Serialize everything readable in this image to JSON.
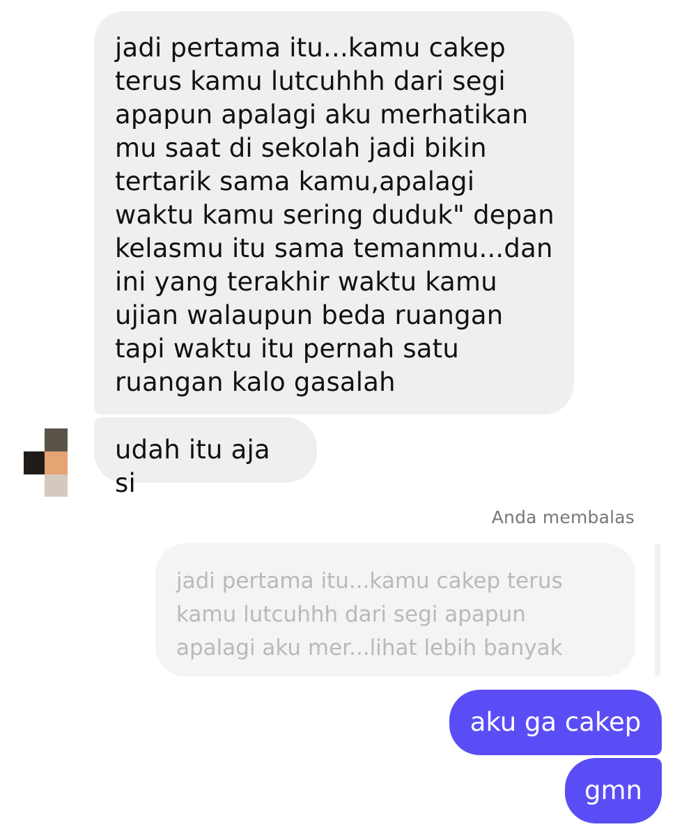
{
  "conversation": {
    "incoming_messages": [
      {
        "text": "jadi pertama itu...kamu cakep\nterus kamu lutcuhhh dari segi\napapun apalagi aku merhatikan\nmu saat di sekolah jadi bikin\ntertarik sama kamu,apalagi\nwaktu kamu sering duduk\" depan\nkelasmu itu sama temanmu...dan\nini yang terakhir waktu kamu\nujian walaupun beda ruangan\ntapi waktu itu pernah satu\nruangan kalo gasalah"
      },
      {
        "text": "udah itu aja si"
      }
    ],
    "reply_context": {
      "label": "Anda membalas",
      "quoted_text": "jadi pertama itu...kamu cakep terus\nkamu lutcuhhh dari segi apapun\napalagi aku mer...lihat lebih banyak"
    },
    "outgoing_messages": [
      {
        "text": "aku ga cakep"
      },
      {
        "text": "gmn"
      }
    ]
  },
  "theme": {
    "incoming_bubble": "#efefef",
    "outgoing_bubble": "#5b4df5",
    "quoted_bubble": "#f4f4f4",
    "meta_text": "#777777",
    "quoted_text": "#b9b9b9"
  },
  "avatar": {
    "icon": "pixelated-profile-avatar",
    "pixel_colors": [
      "#5a5349",
      "#1f1c19",
      "#e6a374",
      "#d4c8bf"
    ]
  }
}
